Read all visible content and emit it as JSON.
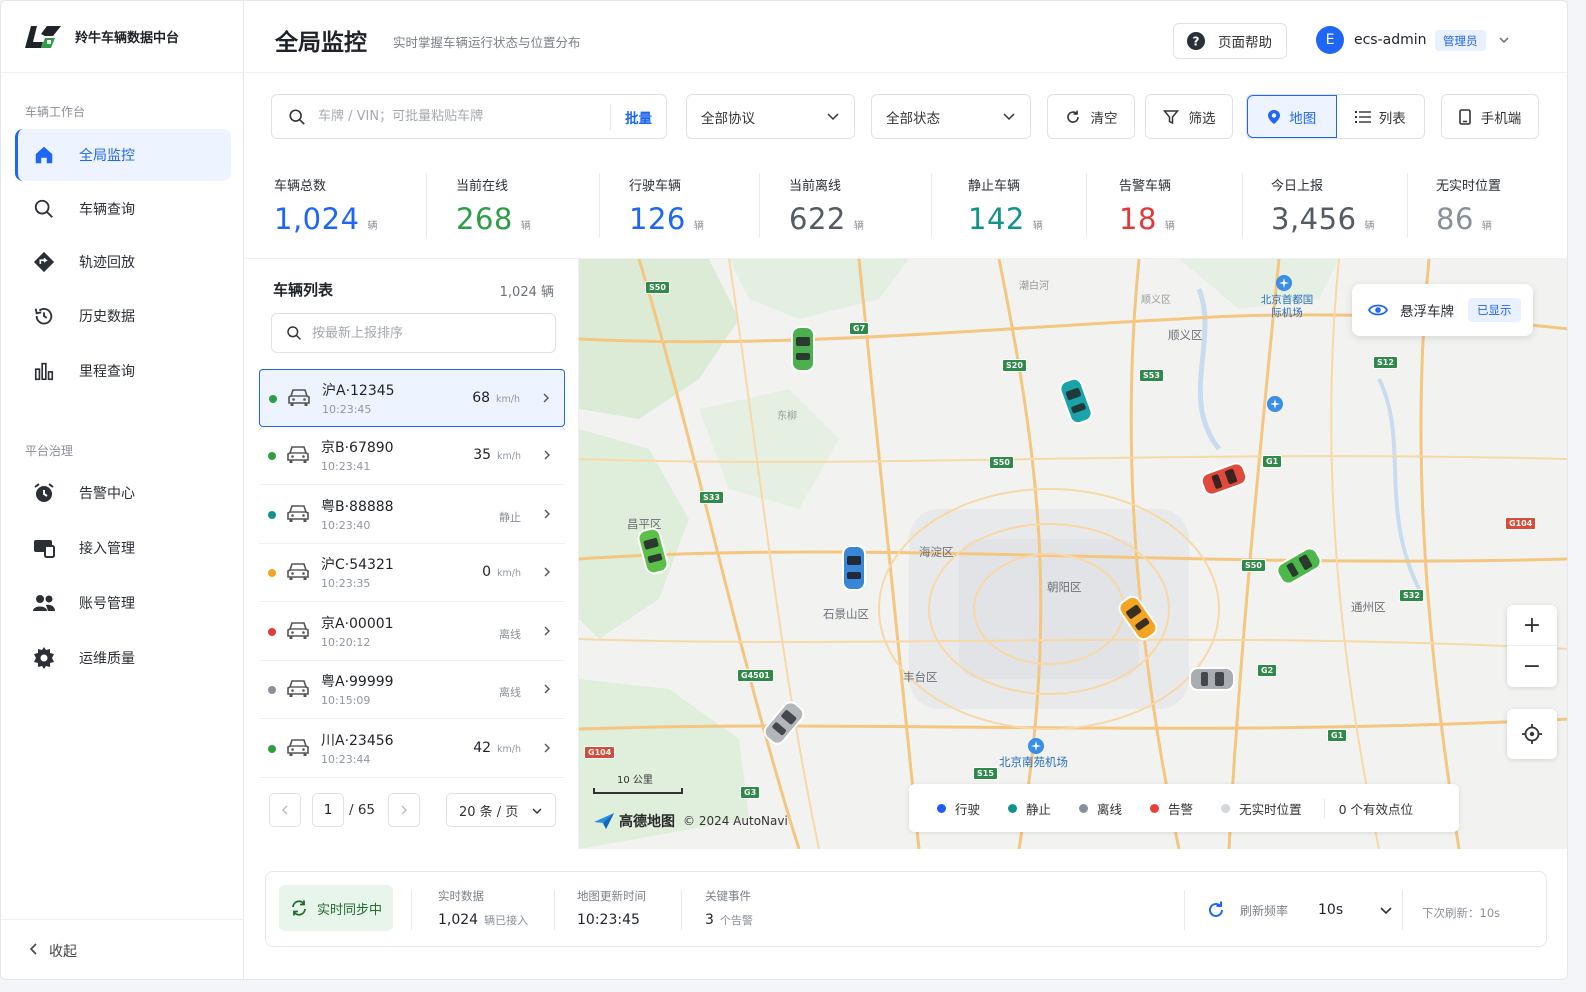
{
  "brand": {
    "name": "羚牛车辆数据中台"
  },
  "sidebar": {
    "group1": "车辆工作台",
    "group2": "平台治理",
    "items": [
      {
        "label": "全局监控",
        "icon": "home-icon"
      },
      {
        "label": "车辆查询",
        "icon": "search-icon"
      },
      {
        "label": "轨迹回放",
        "icon": "route-icon"
      },
      {
        "label": "历史数据",
        "icon": "history-icon"
      },
      {
        "label": "里程查询",
        "icon": "bar-chart-icon"
      },
      {
        "label": "告警中心",
        "icon": "alarm-icon"
      },
      {
        "label": "接入管理",
        "icon": "device-icon"
      },
      {
        "label": "账号管理",
        "icon": "users-icon"
      },
      {
        "label": "运维质量",
        "icon": "gear-icon"
      }
    ],
    "collapse": "收起"
  },
  "header": {
    "title": "全局监控",
    "subtitle": "实时掌握车辆运行状态与位置分布",
    "help": "页面帮助",
    "avatar_letter": "E",
    "user": "ecs-admin",
    "role": "管理员"
  },
  "toolbar": {
    "search_placeholder": "车牌 / VIN；可批量粘贴车牌",
    "batch": "批量",
    "protocol": "全部协议",
    "status": "全部状态",
    "clear": "清空",
    "filter": "筛选",
    "map": "地图",
    "list": "列表",
    "mobile": "手机端"
  },
  "stats": [
    {
      "label": "车辆总数",
      "value": "1,024",
      "unit": "辆",
      "color": "#1e66f5"
    },
    {
      "label": "当前在线",
      "value": "268",
      "unit": "辆",
      "color": "#2e9e45"
    },
    {
      "label": "行驶车辆",
      "value": "126",
      "unit": "辆",
      "color": "#1e66f5"
    },
    {
      "label": "当前离线",
      "value": "622",
      "unit": "辆",
      "color": "#555b63"
    },
    {
      "label": "静止车辆",
      "value": "142",
      "unit": "辆",
      "color": "#12948a"
    },
    {
      "label": "告警车辆",
      "value": "18",
      "unit": "辆",
      "color": "#e23a3a"
    },
    {
      "label": "今日上报",
      "value": "3,456",
      "unit": "辆",
      "color": "#555b63"
    },
    {
      "label": "无实时位置",
      "value": "86",
      "unit": "辆",
      "color": "#8a9099"
    }
  ],
  "vehicle_list": {
    "title": "车辆列表",
    "count": "1,024 辆",
    "search_placeholder": "按最新上报排序",
    "rows": [
      {
        "plate": "沪A·12345",
        "time": "10:23:45",
        "speed": "68",
        "unit": "km/h",
        "state": "",
        "dot": "#2e9e45"
      },
      {
        "plate": "京B·67890",
        "time": "10:23:41",
        "speed": "35",
        "unit": "km/h",
        "state": "",
        "dot": "#2e9e45"
      },
      {
        "plate": "粤B·88888",
        "time": "10:23:40",
        "speed": "",
        "unit": "",
        "state": "静止",
        "dot": "#12948a"
      },
      {
        "plate": "沪C·54321",
        "time": "10:23:35",
        "speed": "0",
        "unit": "km/h",
        "state": "",
        "dot": "#f5a524"
      },
      {
        "plate": "京A·00001",
        "time": "10:20:12",
        "speed": "",
        "unit": "",
        "state": "离线",
        "dot": "#e23a3a"
      },
      {
        "plate": "粤A·99999",
        "time": "10:15:09",
        "speed": "",
        "unit": "",
        "state": "离线",
        "dot": "#8a9099"
      },
      {
        "plate": "川A·23456",
        "time": "10:23:44",
        "speed": "42",
        "unit": "km/h",
        "state": "",
        "dot": "#2e9e45"
      }
    ],
    "page_current": "1",
    "page_total": "/ 65",
    "page_size": "20 条 / 页"
  },
  "map": {
    "labels": [
      "海淀区",
      "朝阳区",
      "石景山区",
      "丰台区",
      "通州区",
      "顺义区",
      "昌平区",
      "北京首都国际机场",
      "北京南苑机场",
      "顺义区",
      "东柳",
      "潮白河"
    ],
    "float_plate": "悬浮车牌",
    "float_state": "已显示",
    "zoom_in": "+",
    "zoom_out": "−",
    "scale": "10 公里",
    "vendor": "高德地图",
    "copyright": "© 2024 AutoNavi",
    "legend": [
      {
        "label": "行驶",
        "color": "#1e5cf0"
      },
      {
        "label": "静止",
        "color": "#12948a"
      },
      {
        "label": "离线",
        "color": "#8a9099"
      },
      {
        "label": "告警",
        "color": "#e8413a"
      },
      {
        "label": "无实时位置",
        "color": "#d3d6da"
      }
    ],
    "valid_points": "0 个有效点位",
    "road_badges": [
      "S50",
      "G7",
      "S20",
      "S53",
      "S12",
      "G1",
      "S50",
      "S33",
      "G104",
      "S50",
      "S32",
      "G4501",
      "G2",
      "G104",
      "G1",
      "S15",
      "G3"
    ]
  },
  "statusbar": {
    "sync": "实时同步中",
    "realtime_k": "实时数据",
    "realtime_v": "1,024",
    "realtime_u": "辆已接入",
    "map_k": "地图更新时间",
    "map_v": "10:23:45",
    "event_k": "关键事件",
    "event_v": "3",
    "event_u": "个告警",
    "rate_k": "刷新频率",
    "rate_v": "10s",
    "next": "下次刷新：10s"
  }
}
